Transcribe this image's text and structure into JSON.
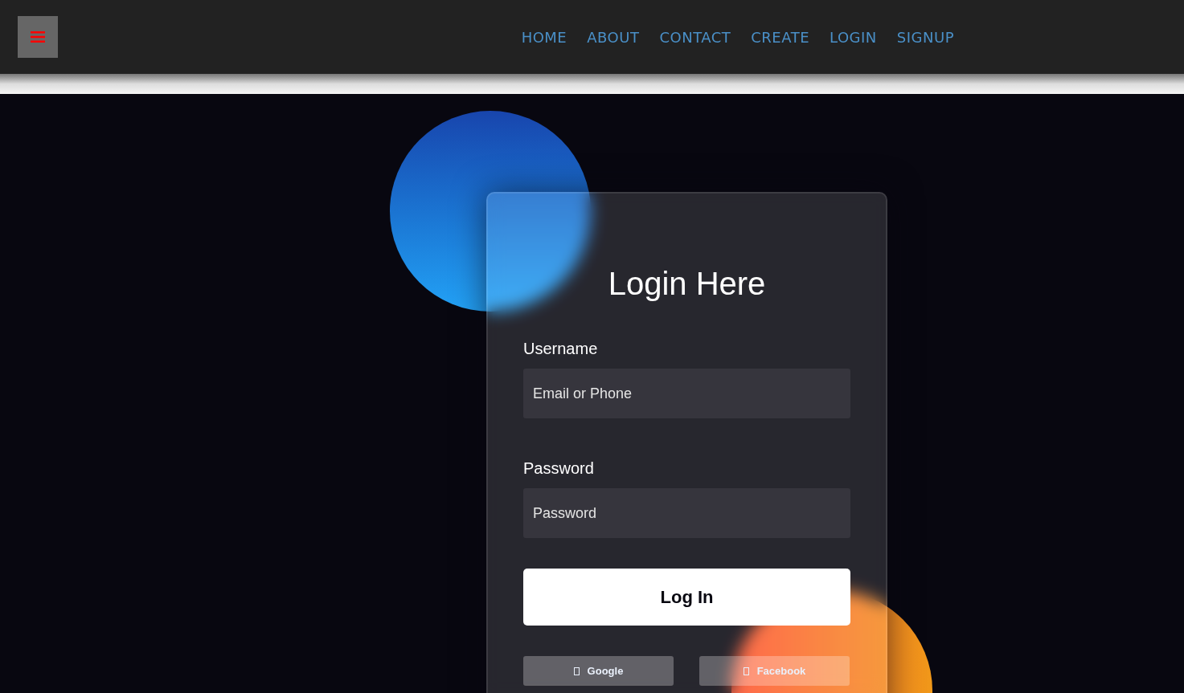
{
  "nav": {
    "links": [
      "HOME",
      "ABOUT",
      "CONTACT",
      "CREATE",
      "LOGIN",
      "SIGNUP"
    ]
  },
  "form": {
    "title": "Login Here",
    "fields": [
      {
        "label": "Username",
        "placeholder": "Email or Phone"
      },
      {
        "label": "Password",
        "placeholder": "Password"
      }
    ],
    "submit": "Log In",
    "social": [
      "Google",
      "Facebook"
    ]
  }
}
